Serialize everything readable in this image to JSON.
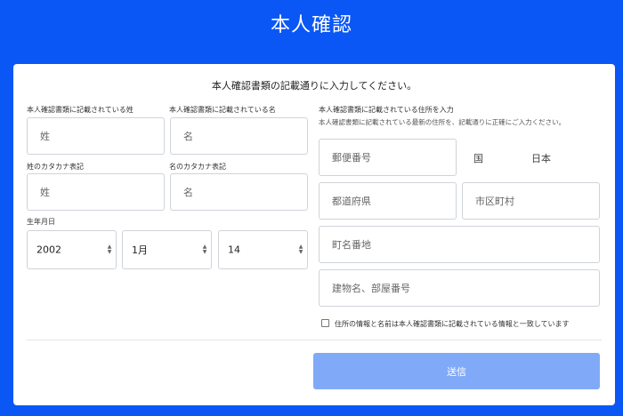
{
  "header": {
    "title": "本人確認"
  },
  "form": {
    "intro": "本人確認書類の記載通りに入力してください。",
    "last_name": {
      "label": "本人確認書類に記載されている姓",
      "placeholder": "姓"
    },
    "first_name": {
      "label": "本人確認書類に記載されている名",
      "placeholder": "名"
    },
    "last_name_kana": {
      "label": "姓のカタカナ表記",
      "placeholder": "姓"
    },
    "first_name_kana": {
      "label": "名のカタカナ表記",
      "placeholder": "名"
    },
    "birthdate": {
      "label": "生年月日",
      "year": "2002",
      "month": "1月",
      "day": "14"
    },
    "address": {
      "label": "本人確認書類に記載されている住所を入力",
      "note": "本人確認書類に記載されている最新の住所を、記載通りに正確にご入力ください。",
      "postal_placeholder": "郵便番号",
      "country_label": "国",
      "country_value": "日本",
      "prefecture_placeholder": "都道府県",
      "city_placeholder": "市区町村",
      "street_placeholder": "町名番地",
      "building_placeholder": "建物名、部屋番号"
    },
    "consent_text": "住所の情報と名前は本人確認書類に記載されている情報と一致しています",
    "consent_checked": false,
    "submit_label": "送信"
  },
  "colors": {
    "background": "#0a57f5",
    "submit_disabled": "#80aaf8",
    "field_border": "#cfd3d8"
  }
}
